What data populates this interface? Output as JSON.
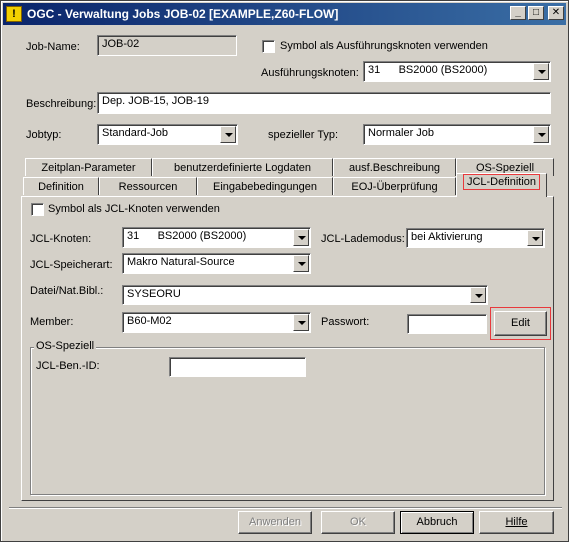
{
  "window": {
    "title": "OGC - Verwaltung Jobs JOB-02 [EXAMPLE,Z60-FLOW]",
    "icon": "!",
    "minimize_glyph": "_",
    "maximize_glyph": "□",
    "close_glyph": "✕"
  },
  "form": {
    "job_name_label": "Job-Name:",
    "job_name_value": "JOB-02",
    "exec_node_checkbox_label": "Symbol als Ausführungsknoten verwenden",
    "exec_node_label": "Ausführungsknoten:",
    "exec_node_value": "31      BS2000 (BS2000)",
    "description_label": "Beschreibung:",
    "description_value": "Dep. JOB-15, JOB-19",
    "jobtype_label": "Jobtyp:",
    "jobtype_value": "Standard-Job",
    "special_type_label": "spezieller Typ:",
    "special_type_value": "Normaler Job"
  },
  "tabs_row1": [
    "Zeitplan-Parameter",
    "benutzerdefinierte Logdaten",
    "ausf.Beschreibung",
    "OS-Speziell"
  ],
  "tabs_row2": [
    "Definition",
    "Ressourcen",
    "Eingabebedingungen",
    "EOJ-Überprüfung",
    "JCL-Definition"
  ],
  "jcl": {
    "symbol_checkbox_label": "Symbol als JCL-Knoten verwenden",
    "node_label": "JCL-Knoten:",
    "node_value": "31      BS2000 (BS2000)",
    "load_mode_label": "JCL-Lademodus:",
    "load_mode_value": "bei Aktivierung",
    "storage_label": "JCL-Speicherart:",
    "storage_value": "Makro Natural-Source",
    "file_label": "Datei/Nat.Bibl.:",
    "file_value": "SYSEORU",
    "member_label": "Member:",
    "member_value": "B60-M02",
    "password_label": "Passwort:",
    "password_value": "",
    "edit_button": "Edit",
    "os_group_title": "OS-Speziell",
    "user_id_label": "JCL-Ben.-ID:",
    "user_id_value": ""
  },
  "buttons": {
    "apply": "Anwenden",
    "ok": "OK",
    "cancel": "Abbruch",
    "help": "Hilfe"
  },
  "colors": {
    "highlight": "#e8393c",
    "titlebar": "#0a246a",
    "face": "#d4d0c8"
  }
}
